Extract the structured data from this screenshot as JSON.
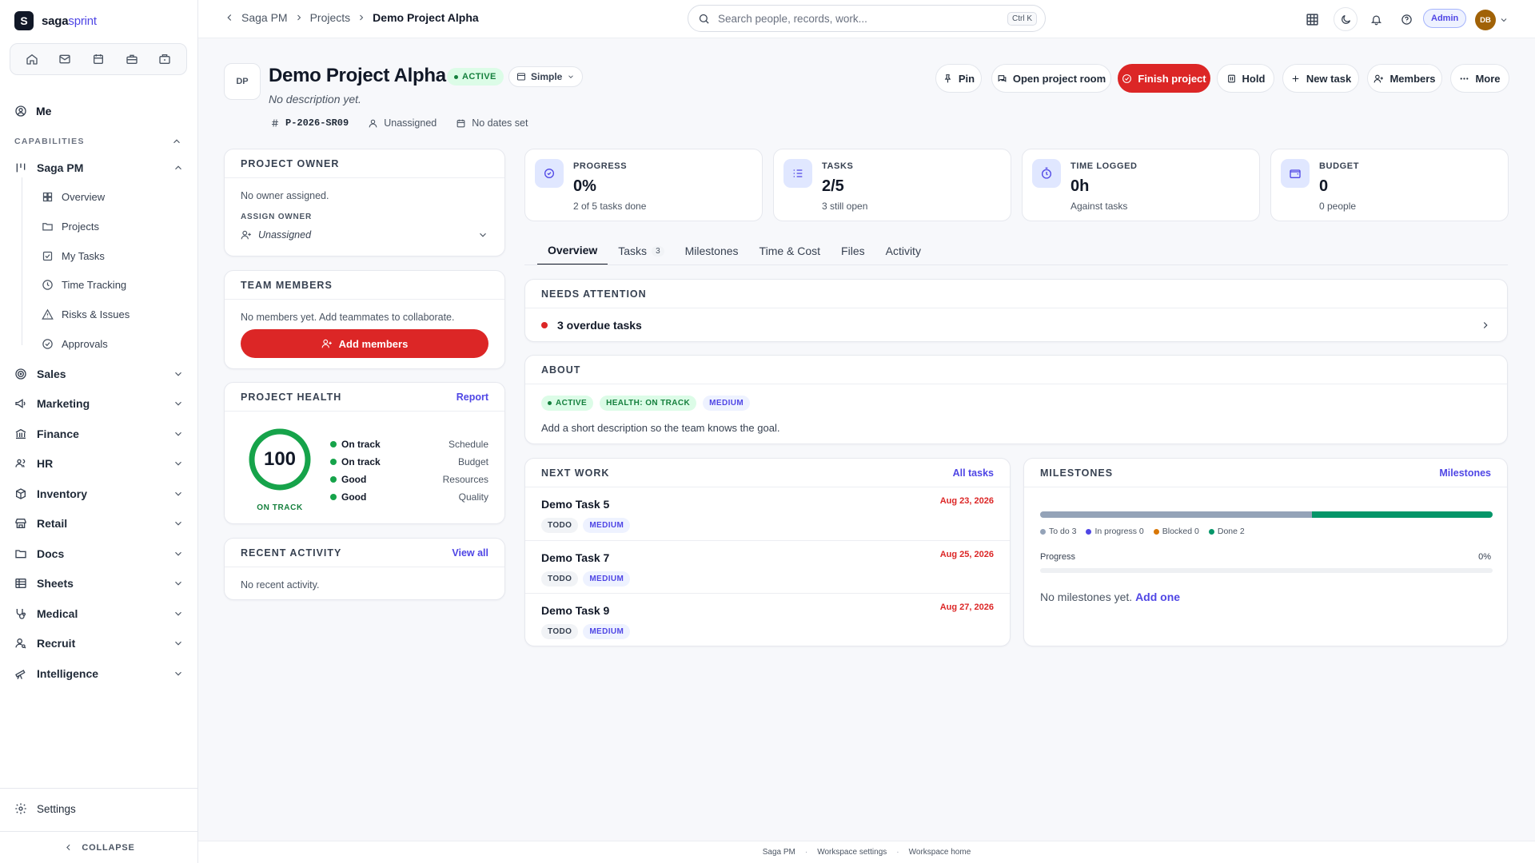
{
  "app": {
    "brand_a": "saga",
    "brand_b": "sprint",
    "logo_letter": "S"
  },
  "sidebar": {
    "me_label": "Me",
    "capabilities_label": "CAPABILITIES",
    "group_label": "Saga PM",
    "sub_items": [
      "Overview",
      "Projects",
      "My Tasks",
      "Time Tracking",
      "Risks & Issues",
      "Approvals"
    ],
    "modules": [
      "Sales",
      "Marketing",
      "Finance",
      "HR",
      "Inventory",
      "Retail",
      "Docs",
      "Sheets",
      "Medical",
      "Recruit",
      "Intelligence"
    ],
    "settings_label": "Settings",
    "collapse_label": "COLLAPSE"
  },
  "topbar": {
    "crumbs": [
      "Saga PM",
      "Projects",
      "Demo Project Alpha"
    ],
    "search_placeholder": "Search people, records, work...",
    "search_kbd": "Ctrl K",
    "admin_label": "Admin",
    "avatar_initials": "DB"
  },
  "project": {
    "initials": "DP",
    "title": "Demo Project Alpha",
    "status": "ACTIVE",
    "mode": "Simple",
    "description": "No description yet.",
    "code": "P-2026-SR09",
    "assignee": "Unassigned",
    "dates": "No dates set"
  },
  "actions": {
    "pin": "Pin",
    "room": "Open project room",
    "finish": "Finish project",
    "hold": "Hold",
    "new_task": "New task",
    "members": "Members",
    "more": "More"
  },
  "owner_card": {
    "title": "PROJECT OWNER",
    "empty": "No owner assigned.",
    "assign_label": "ASSIGN OWNER",
    "assign_value": "Unassigned"
  },
  "team_card": {
    "title": "TEAM MEMBERS",
    "empty": "No members yet. Add teammates to collaborate.",
    "button": "Add members"
  },
  "health_card": {
    "title": "PROJECT HEALTH",
    "link": "Report",
    "score": "100",
    "score_value": 100,
    "score_label": "ON TRACK",
    "rows": [
      {
        "status": "On track",
        "metric": "Schedule"
      },
      {
        "status": "On track",
        "metric": "Budget"
      },
      {
        "status": "Good",
        "metric": "Resources"
      },
      {
        "status": "Good",
        "metric": "Quality"
      }
    ]
  },
  "activity_card": {
    "title": "RECENT ACTIVITY",
    "link": "View all",
    "empty": "No recent activity."
  },
  "stats": [
    {
      "label": "PROGRESS",
      "value": "0%",
      "sub": "2 of 5 tasks done",
      "icon": "target-icon"
    },
    {
      "label": "TASKS",
      "value": "2/5",
      "sub": "3 still open",
      "icon": "list-icon"
    },
    {
      "label": "TIME LOGGED",
      "value": "0h",
      "sub": "Against tasks",
      "icon": "timer-icon"
    },
    {
      "label": "BUDGET",
      "value": "0",
      "sub": "0 people",
      "icon": "wallet-icon"
    }
  ],
  "tabs": [
    {
      "label": "Overview"
    },
    {
      "label": "Tasks",
      "count": "3"
    },
    {
      "label": "Milestones"
    },
    {
      "label": "Time & Cost"
    },
    {
      "label": "Files"
    },
    {
      "label": "Activity"
    }
  ],
  "attention": {
    "title": "NEEDS ATTENTION",
    "item": "3 overdue tasks"
  },
  "about": {
    "title": "ABOUT",
    "pills": [
      "ACTIVE",
      "HEALTH: ON TRACK",
      "MEDIUM"
    ],
    "text": "Add a short description so the team knows the goal."
  },
  "next_work": {
    "title": "NEXT WORK",
    "link": "All tasks",
    "tasks": [
      {
        "name": "Demo Task 5",
        "due": "Aug 23, 2026",
        "status": "TODO",
        "priority": "MEDIUM"
      },
      {
        "name": "Demo Task 7",
        "due": "Aug 25, 2026",
        "status": "TODO",
        "priority": "MEDIUM"
      },
      {
        "name": "Demo Task 9",
        "due": "Aug 27, 2026",
        "status": "TODO",
        "priority": "MEDIUM"
      }
    ]
  },
  "milestones": {
    "title": "MILESTONES",
    "link": "Milestones",
    "legend": [
      "To do 3",
      "In progress 0",
      "Blocked 0",
      "Done 2"
    ],
    "counts": {
      "todo": 3,
      "in_progress": 0,
      "blocked": 0,
      "done": 2
    },
    "progress_label": "Progress",
    "progress_value": "0%",
    "empty": "No milestones yet.",
    "add_link": "Add one"
  },
  "footer": [
    "Saga PM",
    "Workspace settings",
    "Workspace home"
  ],
  "colors": {
    "accent": "#4f46e5",
    "danger": "#dc2626",
    "success": "#16a34a",
    "todo": "#94a3b8",
    "done": "#059669",
    "blocked": "#d97706"
  }
}
